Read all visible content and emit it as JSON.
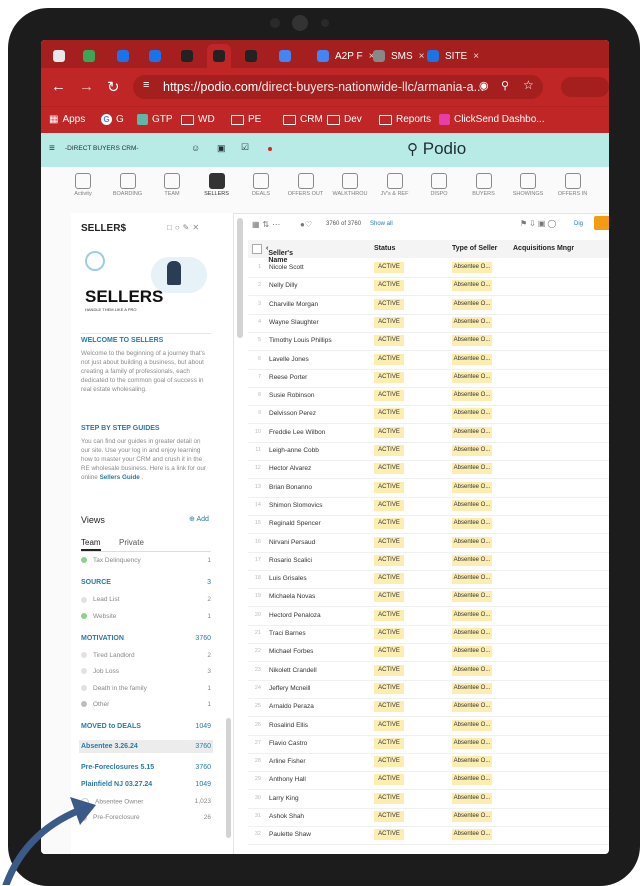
{
  "browser": {
    "tabs": [
      {
        "label": "",
        "color": "#e8e8e8"
      },
      {
        "label": "",
        "color": "#3aa757"
      },
      {
        "label": "",
        "color": "#1a73e8"
      },
      {
        "label": "",
        "color": "#1a73e8"
      },
      {
        "label": "",
        "color": "#222222"
      },
      {
        "label": "",
        "color": "#222222",
        "active": true
      },
      {
        "label": "",
        "color": "#222222"
      },
      {
        "label": "",
        "color": "#4285f4"
      },
      {
        "label": "A2P F",
        "color": "#4285f4"
      },
      {
        "label": "SMS",
        "color": "#888888"
      },
      {
        "label": "SITE",
        "color": "#1a73e8"
      }
    ],
    "url_host": "https://podio.com",
    "url_path": "/direct-buyers-nationwide-llc/armania-a...",
    "bookmarks": [
      "Apps",
      "G",
      "GTP",
      "WD",
      "PE",
      "CRM",
      "Dev",
      "Reports",
      "ClickSend Dashbo..."
    ]
  },
  "podio": {
    "workspace": "-DIRECT BUYERS CRM-",
    "brand": "Podio",
    "apps": [
      "Activity",
      "BOARDING",
      "TEAM",
      "SELLERS",
      "DEALS",
      "OFFERS OUT",
      "WALKTHROU",
      "JV's & REF",
      "DISPO",
      "BUYERS",
      "SHOWINGS",
      "OFFERS IN"
    ]
  },
  "sidebar": {
    "title": "SELLER$",
    "banner_title": "SELLERS",
    "banner_sub": "HANDLE THEM LIKE A PRO",
    "welcome_heading": "WELCOME TO SELLERS",
    "welcome_text": "Welcome to the beginning of a journey that's not just about building a business, but about creating a family of professionals, each dedicated to the common goal of success in real estate wholesaling.",
    "guide_heading": "STEP BY STEP GUIDES",
    "guide_text": "You can find our guides in greater detail on our site. Use your log in and enjoy learning how to master your CRM and crush it in the RE wholesale business. Here is a link for our online",
    "guide_link": "Sellers Guide",
    "views_label": "Views",
    "add_label": "Add",
    "tab_team": "Team",
    "tab_private": "Private",
    "view_items": [
      {
        "type": "item",
        "label": "Tax Delinquency",
        "count": "1",
        "dot": "#8ed08e"
      },
      {
        "type": "head",
        "label": "SOURCE",
        "count": "3"
      },
      {
        "type": "item",
        "label": "Lead List",
        "count": "2",
        "dot": "#e2e2e2"
      },
      {
        "type": "item",
        "label": "Website",
        "count": "1",
        "dot": "#8ed08e"
      },
      {
        "type": "head",
        "label": "MOTIVATION",
        "count": "3760"
      },
      {
        "type": "item",
        "label": "Tired Landlord",
        "count": "2",
        "dot": "#e2e2e2"
      },
      {
        "type": "item",
        "label": "Job Loss",
        "count": "3",
        "dot": "#e2e2e2"
      },
      {
        "type": "item",
        "label": "Death in the family",
        "count": "1",
        "dot": "#e2e2e2"
      },
      {
        "type": "item",
        "label": "Other",
        "count": "1",
        "dot": "#bdbdbd"
      },
      {
        "type": "head",
        "label": "MOVED to DEALS",
        "count": "1049"
      },
      {
        "type": "headsel",
        "label": "Absentee 3.26.24",
        "count": "3760"
      },
      {
        "type": "head",
        "label": "Pre-Foreclosures 5.15",
        "count": "3760"
      },
      {
        "type": "head",
        "label": "Plainfield NJ 03.27.24",
        "count": "1049"
      },
      {
        "type": "item",
        "label": "Absentee Owner",
        "count": "1,023",
        "dot": "#ffffff"
      },
      {
        "type": "item",
        "label": "Pre-Foreclosure",
        "count": "26",
        "dot": "#f3b6b6"
      }
    ]
  },
  "table": {
    "count_text": "3760 of 3760",
    "show_all": "Show all",
    "extra_label": "Dig",
    "columns": [
      "Seller's Name",
      "Status",
      "Type of Seller",
      "Acquisitions Mngr"
    ],
    "rows": [
      {
        "n": "1",
        "name": "Nicole Scott"
      },
      {
        "n": "2",
        "name": "Nelly Dilly"
      },
      {
        "n": "3",
        "name": "Charville Morgan"
      },
      {
        "n": "4",
        "name": "Wayne Slaughter"
      },
      {
        "n": "5",
        "name": "Timothy Louis Phillips"
      },
      {
        "n": "6",
        "name": "Lavelle Jones"
      },
      {
        "n": "7",
        "name": "Reese Porter"
      },
      {
        "n": "8",
        "name": "Susie Robinson"
      },
      {
        "n": "9",
        "name": "Delvisson Perez"
      },
      {
        "n": "10",
        "name": "Freddie Lee Wilbon"
      },
      {
        "n": "11",
        "name": "Leigh-anne Cobb"
      },
      {
        "n": "12",
        "name": "Hector Alvarez"
      },
      {
        "n": "13",
        "name": "Brian Bonanno"
      },
      {
        "n": "14",
        "name": "Shimon Slomovics"
      },
      {
        "n": "15",
        "name": "Reginald Spencer"
      },
      {
        "n": "16",
        "name": "Nirvani Persaud"
      },
      {
        "n": "17",
        "name": "Rosario Scalici"
      },
      {
        "n": "18",
        "name": "Luis Grisales"
      },
      {
        "n": "19",
        "name": "Michaela Novas"
      },
      {
        "n": "20",
        "name": "Hectord Penaloza"
      },
      {
        "n": "21",
        "name": "Traci Barnes"
      },
      {
        "n": "22",
        "name": "Michael Forbes"
      },
      {
        "n": "23",
        "name": "Nikolett Crandell"
      },
      {
        "n": "24",
        "name": "Jeffery Mcneill"
      },
      {
        "n": "25",
        "name": "Arnaldo Peraza"
      },
      {
        "n": "26",
        "name": "Rosalind Ellis"
      },
      {
        "n": "27",
        "name": "Flavio Castro"
      },
      {
        "n": "28",
        "name": "Arline Fisher"
      },
      {
        "n": "29",
        "name": "Anthony Hall"
      },
      {
        "n": "30",
        "name": "Larry King"
      },
      {
        "n": "31",
        "name": "Ashok Shah"
      },
      {
        "n": "32",
        "name": "Paulette Shaw"
      }
    ],
    "status_value": "ACTIVE",
    "type_value": "Absentee O..."
  }
}
